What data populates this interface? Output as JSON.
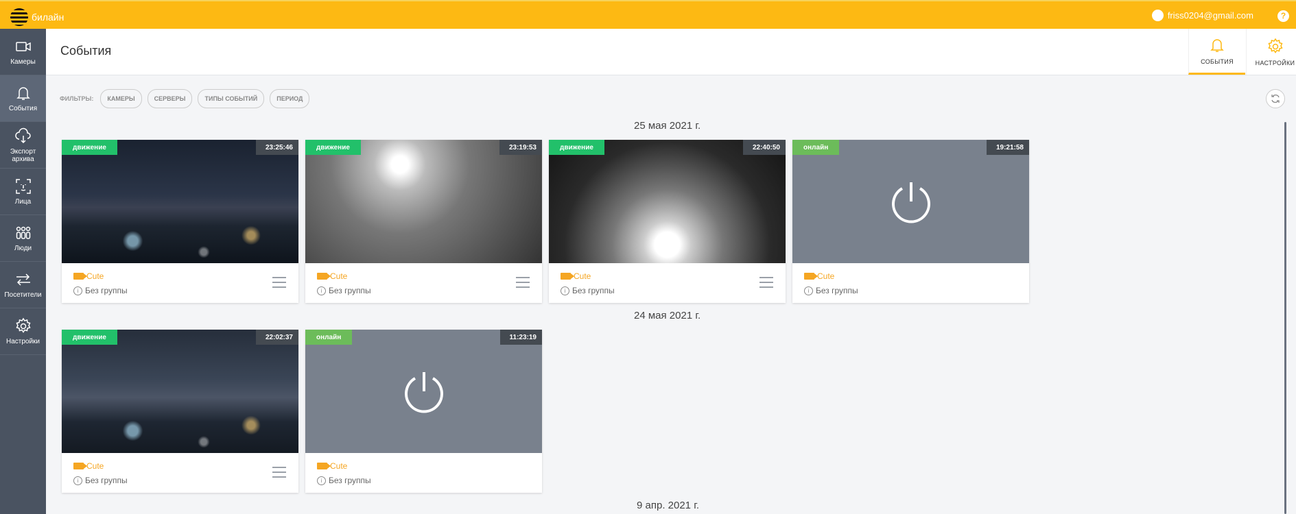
{
  "brand": {
    "name": "билайн"
  },
  "user": {
    "email": "friss0204@gmail.com",
    "help": "?"
  },
  "sidebar": {
    "items": [
      {
        "label": "Камеры",
        "icon": "camera-icon"
      },
      {
        "label": "События",
        "icon": "bell-icon",
        "active": true
      },
      {
        "label": "Экспорт архива",
        "icon": "cloud-download-icon"
      },
      {
        "label": "Лица",
        "icon": "face-icon"
      },
      {
        "label": "Люди",
        "icon": "people-icon"
      },
      {
        "label": "Посетители",
        "icon": "visitors-icon"
      },
      {
        "label": "Настройки",
        "icon": "gear-icon"
      }
    ]
  },
  "header": {
    "title": "События",
    "tabs": [
      {
        "label": "СОБЫТИЯ",
        "icon": "bell-icon",
        "active": true
      },
      {
        "label": "НАСТРОЙКИ",
        "icon": "gear-icon"
      }
    ]
  },
  "filters": {
    "label": "ФИЛЬТРЫ:",
    "chips": [
      "КАМЕРЫ",
      "СЕРВЕРЫ",
      "ТИПЫ СОБЫТИЙ",
      "ПЕРИОД"
    ]
  },
  "groups": [
    {
      "date": "25 мая 2021 г.",
      "events": [
        {
          "type": "движение",
          "time": "23:25:46",
          "camera": "Cute",
          "group": "Без группы",
          "has_menu": true
        },
        {
          "type": "движение",
          "time": "23:19:53",
          "camera": "Cute",
          "group": "Без группы",
          "has_menu": true
        },
        {
          "type": "движение",
          "time": "22:40:50",
          "camera": "Cute",
          "group": "Без группы",
          "has_menu": true
        },
        {
          "type": "онлайн",
          "time": "19:21:58",
          "camera": "Cute",
          "group": "Без группы",
          "has_menu": false
        }
      ]
    },
    {
      "date": "24 мая 2021 г.",
      "events": [
        {
          "type": "движение",
          "time": "22:02:37",
          "camera": "Cute",
          "group": "Без группы",
          "has_menu": true
        },
        {
          "type": "онлайн",
          "time": "11:23:19",
          "camera": "Cute",
          "group": "Без группы",
          "has_menu": false
        }
      ]
    },
    {
      "date": "9 апр. 2021 г.",
      "events": []
    }
  ],
  "colors": {
    "accent": "#fdb913",
    "sidebar": "#4a5361",
    "motion": "#22c06a",
    "online": "#6cbc5a"
  }
}
